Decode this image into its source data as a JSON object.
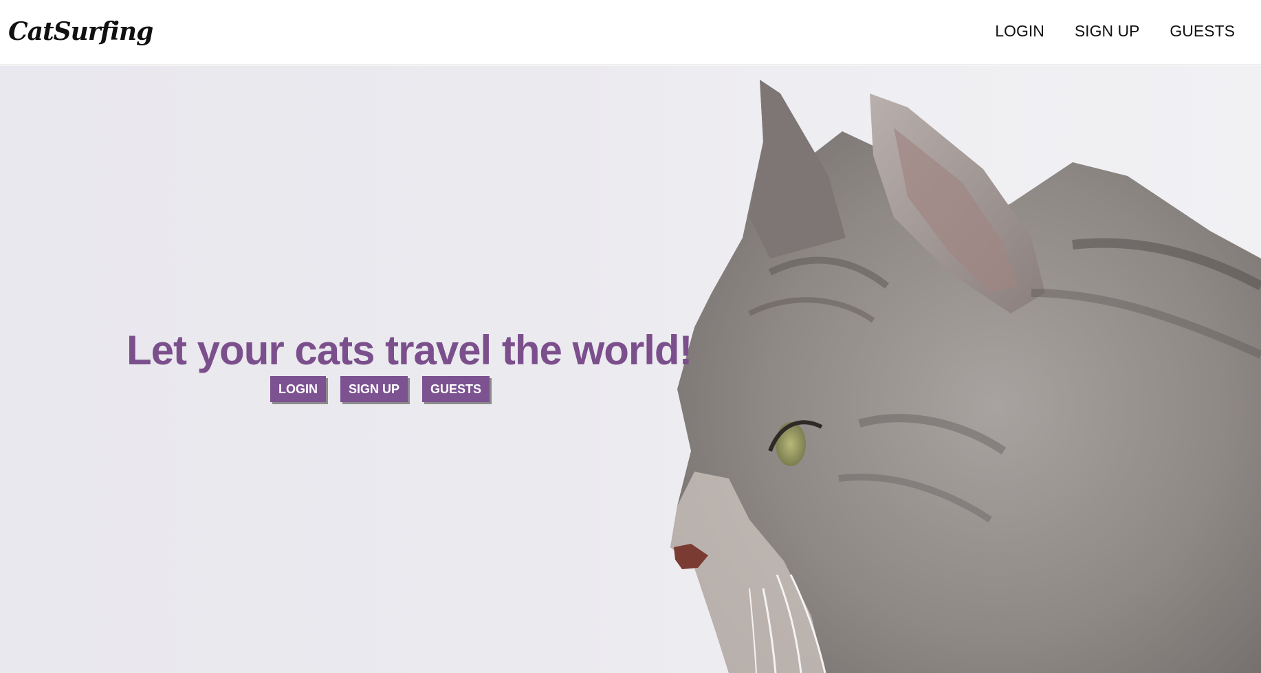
{
  "app": {
    "logo": "CatSurfing"
  },
  "nav": {
    "items": [
      {
        "label": "LOGIN"
      },
      {
        "label": "SIGN UP"
      },
      {
        "label": "GUESTS"
      }
    ]
  },
  "hero": {
    "title": "Let your cats travel the world!",
    "buttons": [
      {
        "label": "LOGIN"
      },
      {
        "label": "SIGN UP"
      },
      {
        "label": "GUESTS"
      }
    ],
    "image": "tabby-cat-profile-photo"
  },
  "colors": {
    "accent": "#7c5291",
    "title": "#7b4f8c",
    "background": "#ebeaef"
  }
}
